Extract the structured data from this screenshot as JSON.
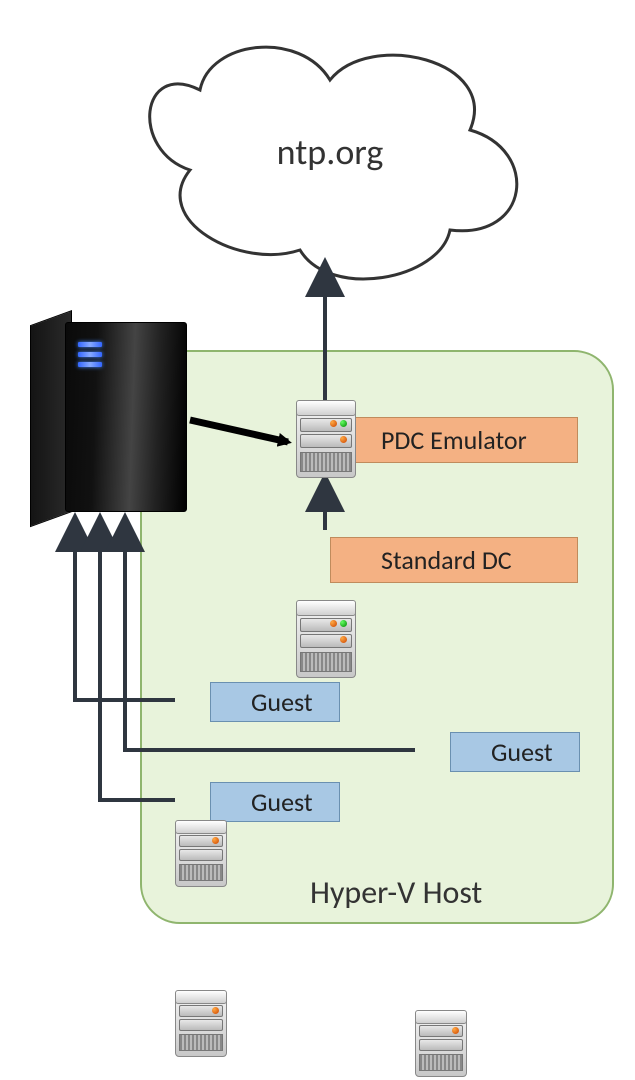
{
  "diagram": {
    "cloud_label": "ntp.org",
    "host_label": "Hyper-V Host",
    "nodes": {
      "host_tower": {
        "role": "Hyper-V host tower"
      },
      "pdc": {
        "label": "PDC Emulator"
      },
      "std_dc": {
        "label": "Standard DC"
      },
      "guest_a": {
        "label": "Guest"
      },
      "guest_b": {
        "label": "Guest"
      },
      "guest_c": {
        "label": "Guest"
      }
    },
    "edges": [
      {
        "from": "pdc",
        "to": "cloud"
      },
      {
        "from": "std_dc",
        "to": "pdc"
      },
      {
        "from": "tower",
        "to": "pdc"
      },
      {
        "from": "guest_a",
        "to": "tower"
      },
      {
        "from": "guest_b",
        "to": "tower"
      },
      {
        "from": "guest_c",
        "to": "tower"
      }
    ],
    "colors": {
      "host_bg": "#e8f3db",
      "dc_bg": "#f4b183",
      "guest_bg": "#a8c8e4"
    }
  }
}
